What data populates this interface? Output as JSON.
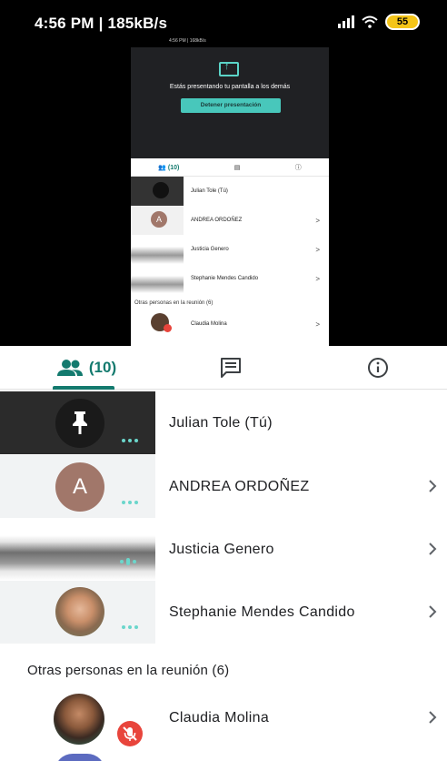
{
  "status_bar": {
    "text": "4:56 PM | 185kB/s",
    "battery": "55"
  },
  "mini": {
    "status_text": "4:56 PM | 168kB/s",
    "presenting_message": "Estás presentando tu pantalla a los demás",
    "stop_button": "Detener presentación",
    "people_count": "(10)",
    "participants": [
      "Julian Tole (Tú)",
      "ANDREA ORDOÑEZ",
      "Justicia Genero",
      "Stephanie Mendes Candido"
    ],
    "others_label": "Otras personas en la reunión (6)",
    "others": [
      "Claudia Molina"
    ]
  },
  "tabs": {
    "people_count": "(10)",
    "people_icon": "people-icon",
    "chat_icon": "chat-icon",
    "info_icon": "info-icon"
  },
  "participants": [
    {
      "name": "Julian Tole (Tú)",
      "icon": "pin-icon"
    },
    {
      "name": "ANDREA ORDOÑEZ",
      "avatar_letter": "A"
    },
    {
      "name": "Justicia Genero"
    },
    {
      "name": "Stephanie Mendes Candido"
    }
  ],
  "others_label": "Otras personas en la reunión (6)",
  "others": [
    {
      "name": "Claudia Molina",
      "icon": "mic-off-icon"
    }
  ],
  "colors": {
    "accent": "#137a6e",
    "mute_red": "#e8453c",
    "avatar_brown": "#a1776a"
  }
}
